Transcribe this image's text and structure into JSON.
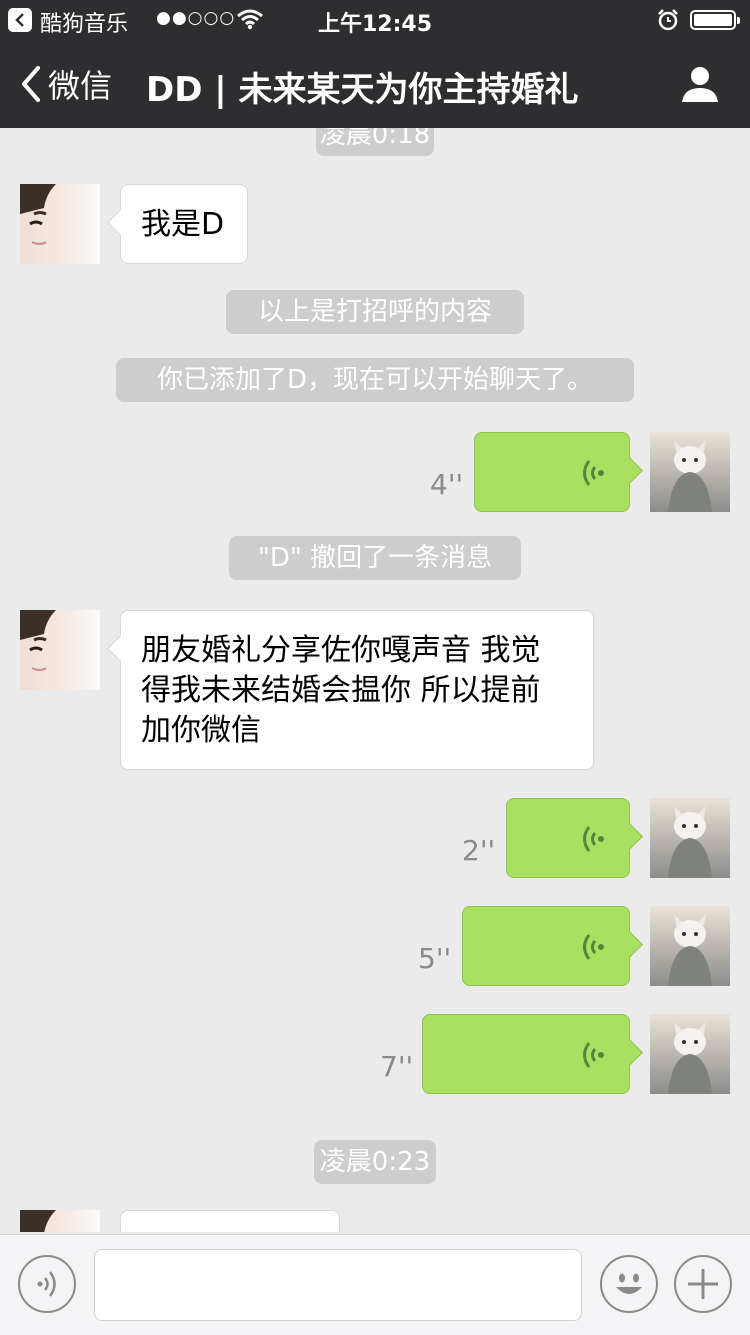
{
  "status_bar": {
    "app_name": "酷狗音乐",
    "signal": "●●○○○",
    "time": "上午12:45"
  },
  "nav": {
    "back_label": "微信",
    "title": "DD | 未来某天为你主持婚礼"
  },
  "messages": [
    {
      "kind": "timestamp",
      "text": "凌晨0:18"
    },
    {
      "kind": "incoming_text",
      "text": "我是D"
    },
    {
      "kind": "system",
      "text": "以上是打招呼的内容"
    },
    {
      "kind": "system",
      "text": "你已添加了D，现在可以开始聊天了。"
    },
    {
      "kind": "outgoing_voice",
      "duration": "4''"
    },
    {
      "kind": "system",
      "text": "\"D\" 撤回了一条消息"
    },
    {
      "kind": "incoming_text",
      "lines": [
        "朋友婚礼分享佐你嘎声音 我觉",
        "得我未来结婚会揾你 所以提前",
        "加你微信"
      ]
    },
    {
      "kind": "outgoing_voice",
      "duration": "2''"
    },
    {
      "kind": "outgoing_voice",
      "duration": "5''"
    },
    {
      "kind": "outgoing_voice",
      "duration": "7''"
    },
    {
      "kind": "timestamp",
      "text": "凌晨0:23"
    },
    {
      "kind": "incoming_text",
      "text": ""
    }
  ],
  "colors": {
    "nav_bg": "#2e2e31",
    "chat_bg": "#ebebeb",
    "outgoing_bubble": "#a9e060",
    "system_pill": "#cdcdcd"
  },
  "icons": {
    "back": "chevron-left-icon",
    "profile": "person-icon",
    "voice": "voice-wave-icon",
    "emoji": "smiley-icon",
    "plus": "plus-icon"
  }
}
